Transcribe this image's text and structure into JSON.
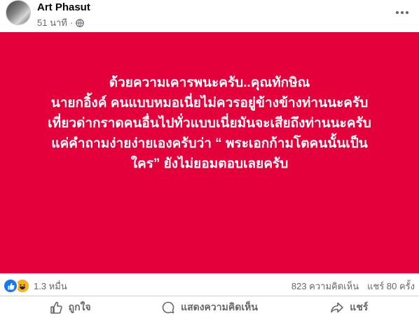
{
  "post": {
    "author": "Art Phasut",
    "time": "51 นาที",
    "privacy_icon": "globe-icon",
    "background_color": "#e4003a",
    "lines": [
      "ด้วยความเคารพนะครับ..คุณทักษิณ",
      "นายกอิ้งค์ คนแบบหมอเนี่ยไม่ควรอยู่ข้างข้างท่านนะครับ",
      "เที่ยวด่ากราดคนอื่นไปทั่วแบบเนี่ยมันจะเสียถึงท่านนะครับ",
      "แค่คำถามง่ายง่ายเองครับว่า “ พระเอกก้ามโตคนนั้นเป็น",
      "ใคร” ยังไม่ยอมตอบเลยครับ"
    ]
  },
  "stats": {
    "reaction_icons": [
      "like-icon",
      "haha-icon"
    ],
    "reactions_count": "1.3 หมื่น",
    "comments": "823 ความคิดเห็น",
    "shares": "แชร์ 80 ครั้ง"
  },
  "actions": {
    "like": "ถูกใจ",
    "comment": "แสดงความคิดเห็น",
    "share": "แชร์"
  }
}
